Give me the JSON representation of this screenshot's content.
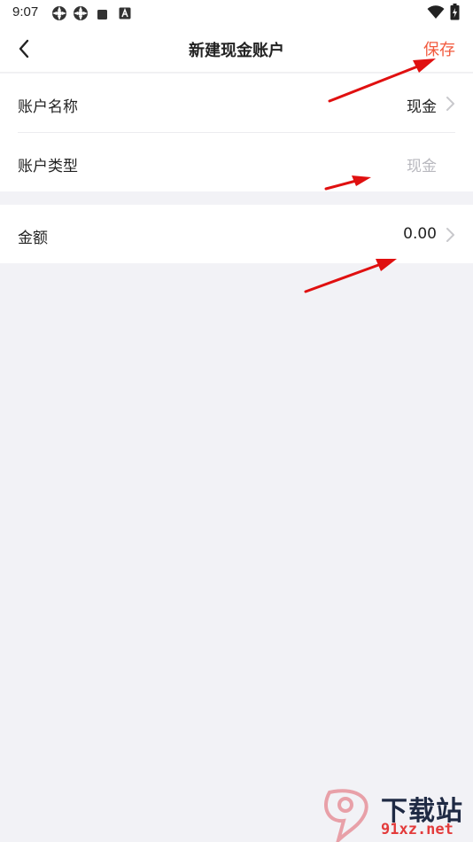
{
  "status_bar": {
    "time": "9:07",
    "left_icons": [
      "settings-gear-icon",
      "settings-gear-icon",
      "stop-square-icon",
      "font-a-icon"
    ],
    "right_icons": [
      "wifi-icon",
      "battery-charging-icon"
    ]
  },
  "nav": {
    "back_icon": "chevron-left-icon",
    "title": "新建现金账户",
    "save_label": "保存"
  },
  "form": {
    "rows": [
      {
        "label": "账户名称",
        "value": "现金",
        "has_chevron": true
      },
      {
        "label": "账户类型",
        "value": "现金",
        "value_muted": true,
        "has_chevron": false
      },
      {
        "label": "金额",
        "value": "0.00",
        "has_chevron": true
      }
    ]
  },
  "watermark": {
    "line1": "下载站",
    "line2": "91xz.net"
  },
  "colors": {
    "accent": "#f25a3e",
    "background": "#f2f2f6",
    "card": "#ffffff",
    "muted_text": "#b8b8be",
    "annotation_arrow": "#e01010"
  }
}
